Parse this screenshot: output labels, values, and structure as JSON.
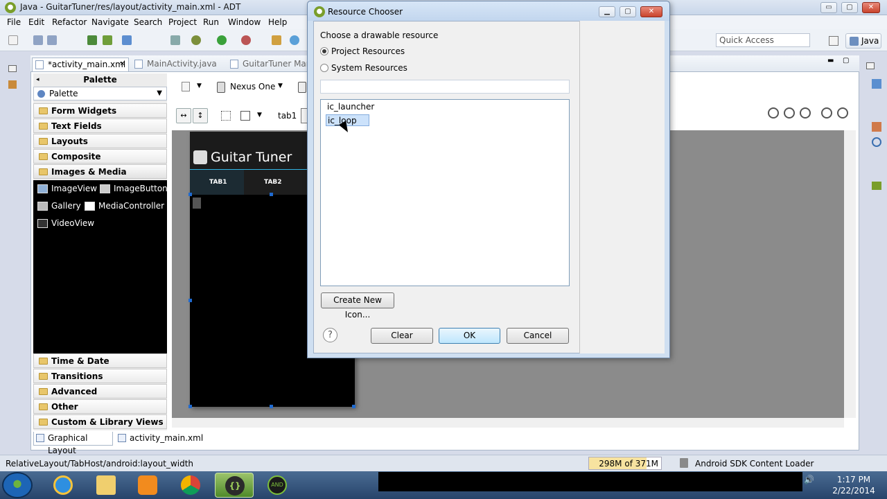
{
  "window": {
    "title": "Java - GuitarTuner/res/layout/activity_main.xml - ADT",
    "min": "▭",
    "max": "▢",
    "close": "✕"
  },
  "menu": [
    "File",
    "Edit",
    "Refactor",
    "Navigate",
    "Search",
    "Project",
    "Run",
    "Window",
    "Help"
  ],
  "quick_access": {
    "placeholder": "Quick Access"
  },
  "perspective": {
    "label": "Java"
  },
  "editor_tabs": [
    {
      "label": "*activity_main.xml",
      "close": "✕"
    },
    {
      "label": "MainActivity.java"
    },
    {
      "label": "GuitarTuner Man"
    }
  ],
  "palette": {
    "header": "Palette",
    "selector": "Palette",
    "categories": [
      "Form Widgets",
      "Text Fields",
      "Layouts",
      "Composite",
      "Images & Media",
      "Time & Date",
      "Transitions",
      "Advanced",
      "Other",
      "Custom & Library Views"
    ],
    "widgets": [
      "ImageView",
      "ImageButton",
      "Gallery",
      "MediaController",
      "VideoView"
    ]
  },
  "layout_toolbar": {
    "device": "Nexus One",
    "tab_label": "tab1"
  },
  "preview": {
    "app_title": "Guitar Tuner",
    "tabs": [
      "TAB1",
      "TAB2"
    ]
  },
  "bottom_tabs": [
    "Graphical Layout",
    "activity_main.xml"
  ],
  "status": {
    "path": "RelativeLayout/TabHost/android:layout_width",
    "memory": "298M of 371M",
    "memory_used_fraction": 0.8,
    "loader": "Android SDK Content Loader"
  },
  "dialog": {
    "title": "Resource Chooser",
    "prompt": "Choose a drawable resource",
    "radio_project": "Project Resources",
    "radio_system": "System Resources",
    "resources": [
      "ic_launcher",
      "ic_loop"
    ],
    "selected_resource": "ic_loop",
    "create_button": "Create New Icon...",
    "help": "?",
    "clear": "Clear",
    "ok": "OK",
    "cancel": "Cancel"
  },
  "taskbar": {
    "clock_time": "1:17 PM",
    "clock_date": "2/22/2014",
    "eclipse_label": "{}",
    "android_label": "AND"
  },
  "colors": {
    "accent_holo": "#33b5e5",
    "selection": "#cce2fb",
    "folder": "#e8c66a",
    "taskbar_bg": "#27446a"
  }
}
